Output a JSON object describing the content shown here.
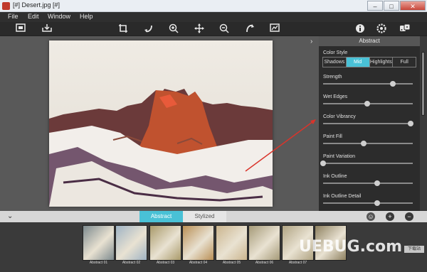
{
  "window": {
    "title": "[#] Desert.jpg [#]",
    "minimize": "–",
    "maximize": "□",
    "close": "✕"
  },
  "menu": [
    "File",
    "Edit",
    "Window",
    "Help"
  ],
  "panel": {
    "header": "Abstract",
    "color_style_label": "Color Style",
    "color_style_options": [
      "Shadows",
      "Mid",
      "Highlights",
      "Full"
    ],
    "color_style_selected": "Mid",
    "sliders": [
      {
        "label": "Strength",
        "value": 0.78
      },
      {
        "label": "Wet Edges",
        "value": 0.49
      },
      {
        "label": "Color Vibrancy",
        "value": 0.98
      },
      {
        "label": "Paint Fill",
        "value": 0.45
      },
      {
        "label": "Paint Variation",
        "value": 0.0
      },
      {
        "label": "Ink Outline",
        "value": 0.6
      },
      {
        "label": "Ink Outline Detail",
        "value": 0.6
      }
    ]
  },
  "bottom": {
    "tabs": [
      "Abstract",
      "Stylized"
    ],
    "active_tab": "Abstract",
    "add": "+",
    "remove": "−"
  },
  "filmstrip": [
    {
      "caption": "Abstract 01",
      "color": "#7d8a8e"
    },
    {
      "caption": "Abstract 02",
      "color": "#9fb3c4"
    },
    {
      "caption": "Abstract 03",
      "color": "#a99a6a"
    },
    {
      "caption": "Abstract 04",
      "color": "#b98f55"
    },
    {
      "caption": "Abstract 05",
      "color": "#cbb58e"
    },
    {
      "caption": "Abstract 06",
      "color": "#a59a78"
    },
    {
      "caption": "Abstract 07",
      "color": "#b0a483"
    },
    {
      "caption": "",
      "color": "#8e8160"
    }
  ],
  "watermark": {
    "text": "UEBUG.com",
    "badge": "下载站"
  }
}
